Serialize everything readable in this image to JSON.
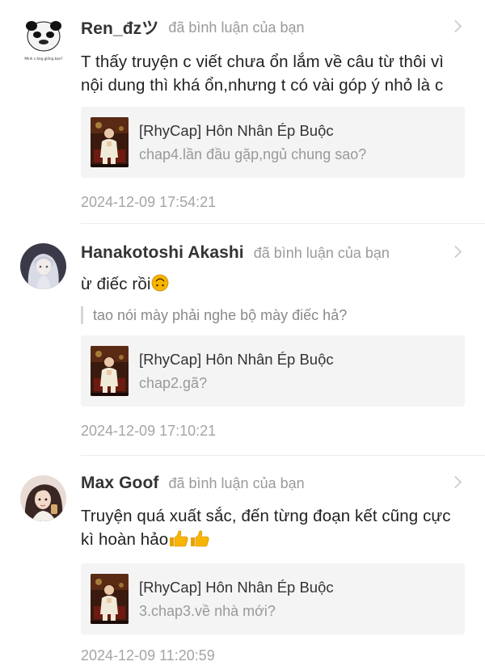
{
  "notifications": [
    {
      "username": "Ren_đzツ",
      "action": "đã bình luận của bạn",
      "comment": "T thấy truyện c viết chưa ổn lắm về câu từ thôi vì nội dung thì khá ổn,nhưng t có vài góp ý nhỏ là c",
      "avatar_caption": "Mình s ăng giống bạn?",
      "story_title": "[RhyCap] Hôn Nhân Ép Buộc",
      "chapter": "chap4.lần đầu gặp,ngủ chung sao?",
      "time": "2024-12-09 17:54:21"
    },
    {
      "username": "Hanakotoshi Akashi",
      "action": "đã bình luận của bạn",
      "comment": "ừ điếc rồi",
      "comment_emoji": "upside-down-face",
      "quote": "tao nói mày phải nghe bộ mày điếc hả?",
      "story_title": "[RhyCap] Hôn Nhân Ép Buộc",
      "chapter": "chap2.gã?",
      "time": "2024-12-09 17:10:21"
    },
    {
      "username": "Max Goof",
      "action": "đã bình luận của bạn",
      "comment_line1": "Truyện quá xuất sắc, đến từng đoạn kết cũng cực",
      "comment_line2": "kì hoàn hảo",
      "comment_emoji": "thumbs-up",
      "story_title": "[RhyCap] Hôn Nhân Ép Buộc",
      "chapter": "3.chap3.về nhà mới?",
      "time": "2024-12-09 11:20:59"
    }
  ],
  "colors": {
    "username": "#333333",
    "muted": "#9a9a9a",
    "card_bg": "#f4f4f4",
    "emoji_yellow": "#f7b500"
  }
}
